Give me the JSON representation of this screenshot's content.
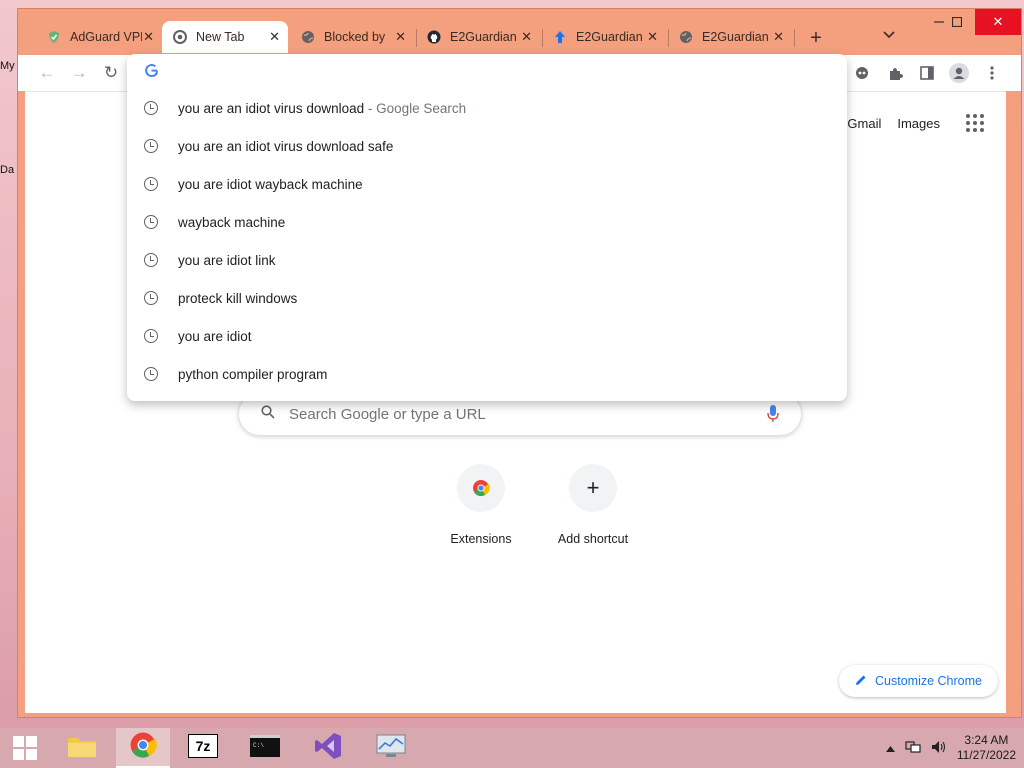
{
  "desktop": {
    "frag1": "My",
    "frag2": "Da"
  },
  "tabs": [
    {
      "title": "AdGuard VPN",
      "icon": "adguard-icon",
      "active": false
    },
    {
      "title": "New Tab",
      "icon": "chrome-icon",
      "active": true
    },
    {
      "title": "Blocked by",
      "icon": "globe-icon",
      "active": false
    },
    {
      "title": "E2Guardian",
      "icon": "github-icon",
      "active": false
    },
    {
      "title": "E2Guardian",
      "icon": "upload-icon",
      "active": false
    },
    {
      "title": "E2Guardian",
      "icon": "globe-icon",
      "active": false
    }
  ],
  "omnibox": {
    "value": "",
    "suggestions": [
      {
        "text": "you are an idiot virus download",
        "suffix": " - Google Search"
      },
      {
        "text": "you are an idiot virus download safe",
        "suffix": ""
      },
      {
        "text": "you are idiot wayback machine",
        "suffix": ""
      },
      {
        "text": "wayback machine",
        "suffix": ""
      },
      {
        "text": "you are idiot link",
        "suffix": ""
      },
      {
        "text": "proteck kill windows",
        "suffix": ""
      },
      {
        "text": "you are idiot",
        "suffix": ""
      },
      {
        "text": "python compiler program",
        "suffix": ""
      }
    ]
  },
  "newtab": {
    "links": {
      "gmail": "Gmail",
      "images": "Images"
    },
    "search_placeholder": "Search Google or type a URL",
    "shortcuts": [
      {
        "label": "Extensions"
      },
      {
        "label": "Add shortcut"
      }
    ],
    "customize_label": "Customize Chrome"
  },
  "taskbar": {
    "time": "3:24 AM",
    "date": "11/27/2022"
  },
  "colors": {
    "titlebar": "#f4a07e",
    "accent": "#1a73e8",
    "close": "#e81123"
  }
}
